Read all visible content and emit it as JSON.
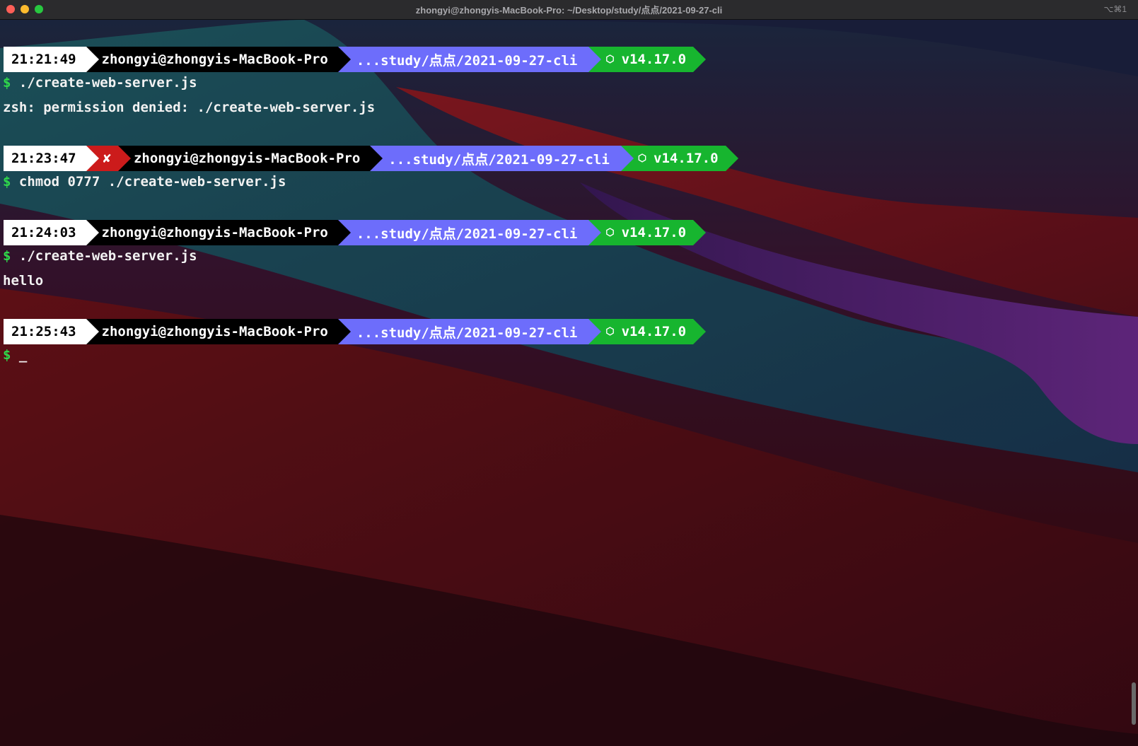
{
  "window": {
    "title": "zhongyi@zhongyis-MacBook-Pro: ~/Desktop/study/点点/2021-09-27-cli",
    "shortcut": "⌥⌘1"
  },
  "prompts": [
    {
      "time": "21:21:49",
      "error": "",
      "user": "zhongyi@zhongyis-MacBook-Pro",
      "path": "...study/点点/2021-09-27-cli",
      "node_icon": "⬡",
      "node": "v14.17.0",
      "command": "./create-web-server.js",
      "output": "zsh: permission denied: ./create-web-server.js"
    },
    {
      "time": "21:23:47",
      "error": "✘",
      "user": "zhongyi@zhongyis-MacBook-Pro",
      "path": "...study/点点/2021-09-27-cli",
      "node_icon": "⬡",
      "node": "v14.17.0",
      "command": "chmod 0777 ./create-web-server.js",
      "output": ""
    },
    {
      "time": "21:24:03",
      "error": "",
      "user": "zhongyi@zhongyis-MacBook-Pro",
      "path": "...study/点点/2021-09-27-cli",
      "node_icon": "⬡",
      "node": "v14.17.0",
      "command": "./create-web-server.js",
      "output": "hello"
    },
    {
      "time": "21:25:43",
      "error": "",
      "user": "zhongyi@zhongyis-MacBook-Pro",
      "path": "...study/点点/2021-09-27-cli",
      "node_icon": "⬡",
      "node": "v14.17.0",
      "command": "",
      "output": ""
    }
  ],
  "prompt_symbol": "$",
  "cursor": "_",
  "colors": {
    "time_bg": "#ffffff",
    "error_bg": "#cc1b1b",
    "user_bg": "#000000",
    "path_bg": "#6d6dfb",
    "node_bg": "#17b52f",
    "prompt_symbol": "#2fd84a"
  }
}
